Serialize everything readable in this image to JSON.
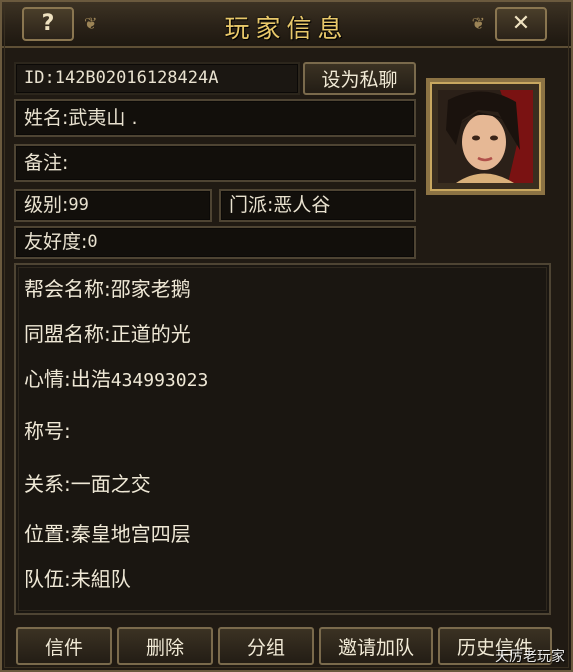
{
  "window": {
    "title": "玩家信息",
    "help_label": "?",
    "close_label": "✕"
  },
  "header": {
    "id_label": "ID:",
    "id_value": "142B02016128424A",
    "private_chat_button": "设为私聊"
  },
  "profile": {
    "name_label": "姓名:",
    "name_value": "武夷山 .",
    "note_label": "备注:",
    "note_value": "",
    "level_label": "级别:",
    "level_value": "99",
    "faction_label": "门派:",
    "faction_value": "恶人谷",
    "friendliness_label": "友好度:",
    "friendliness_value": "0"
  },
  "info": {
    "guild_label": "帮会名称:",
    "guild_value": "邵家老鹅",
    "alliance_label": "同盟名称:",
    "alliance_value": "正道的光",
    "mood_label": "心情:",
    "mood_text": "出浩",
    "mood_number": "434993023",
    "title_label": "称号:",
    "title_value": "",
    "relation_label": "关系:",
    "relation_value": "一面之交",
    "location_label": "位置:",
    "location_value": "秦皇地宫四层",
    "team_label": "队伍:",
    "team_value": "未組队"
  },
  "actions": {
    "mail": "信件",
    "delete": "删除",
    "group": "分组",
    "invite": "邀请加队",
    "history": "历史信件"
  },
  "watermark": "天厉老玩家",
  "colors": {
    "gold_title": "#e8c86a",
    "frame": "#6b5a3e",
    "text": "#e9e2d0"
  }
}
